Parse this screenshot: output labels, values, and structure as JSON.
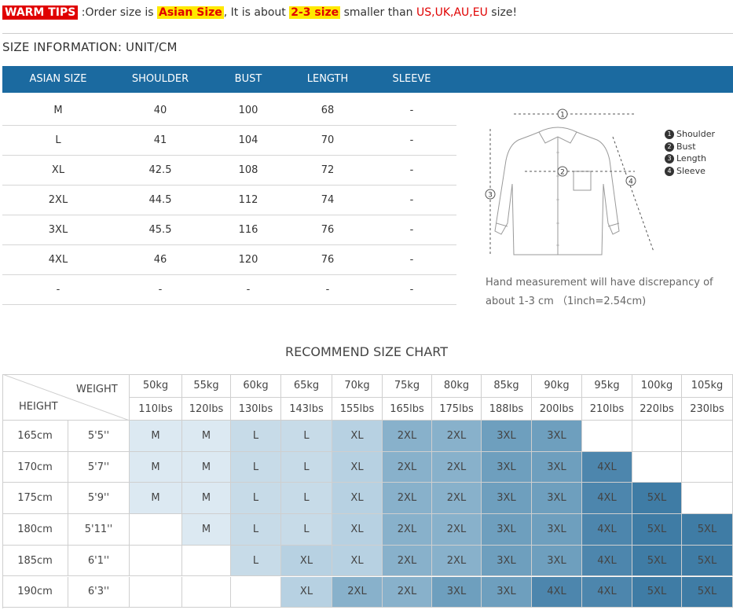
{
  "tips": {
    "tag": "WARM TIPS",
    "p1": " :Order size is ",
    "hl1": "Asian Size",
    "p2": ", It is about ",
    "hl2": "2-3 size",
    "p3": " smaller than ",
    "red": "US,UK,AU,EU",
    "p4": " size!"
  },
  "size_info": "SIZE INFORMATION:  UNIT/CM",
  "size_table": {
    "headers": [
      "ASIAN SIZE",
      "SHOULDER",
      "BUST",
      "LENGTH",
      "SLEEVE"
    ],
    "rows": [
      [
        "M",
        "40",
        "100",
        "68",
        "-"
      ],
      [
        "L",
        "41",
        "104",
        "70",
        "-"
      ],
      [
        "XL",
        "42.5",
        "108",
        "72",
        "-"
      ],
      [
        "2XL",
        "44.5",
        "112",
        "74",
        "-"
      ],
      [
        "3XL",
        "45.5",
        "116",
        "76",
        "-"
      ],
      [
        "4XL",
        "46",
        "120",
        "76",
        "-"
      ],
      [
        "-",
        "-",
        "-",
        "-",
        "-"
      ]
    ]
  },
  "legend": [
    {
      "num": "1",
      "label": "Shoulder"
    },
    {
      "num": "2",
      "label": "Bust"
    },
    {
      "num": "3",
      "label": "Length"
    },
    {
      "num": "4",
      "label": "Sleeve"
    }
  ],
  "diagram_marks": [
    "1",
    "2",
    "3",
    "4"
  ],
  "note_line1": "Hand measurement will have discrepancy of",
  "note_line2": "about 1-3 cm （1inch=2.54cm)",
  "recommend": {
    "title": "RECOMMEND SIZE CHART",
    "weight_label": "WEIGHT",
    "height_label": "HEIGHT",
    "weights_kg": [
      "50kg",
      "55kg",
      "60kg",
      "65kg",
      "70kg",
      "75kg",
      "80kg",
      "85kg",
      "90kg",
      "95kg",
      "100kg",
      "105kg"
    ],
    "weights_lbs": [
      "110lbs",
      "120lbs",
      "130lbs",
      "143lbs",
      "155lbs",
      "165lbs",
      "175lbs",
      "188lbs",
      "200lbs",
      "210lbs",
      "220lbs",
      "230lbs"
    ],
    "rows": [
      {
        "cm": "165cm",
        "ft": "5'5''",
        "sizes": [
          "M",
          "M",
          "L",
          "L",
          "XL",
          "2XL",
          "2XL",
          "3XL",
          "3XL",
          "",
          "",
          ""
        ]
      },
      {
        "cm": "170cm",
        "ft": "5'7''",
        "sizes": [
          "M",
          "M",
          "L",
          "L",
          "XL",
          "2XL",
          "2XL",
          "3XL",
          "3XL",
          "4XL",
          "",
          ""
        ]
      },
      {
        "cm": "175cm",
        "ft": "5'9''",
        "sizes": [
          "M",
          "M",
          "L",
          "L",
          "XL",
          "2XL",
          "2XL",
          "3XL",
          "3XL",
          "4XL",
          "5XL",
          ""
        ]
      },
      {
        "cm": "180cm",
        "ft": "5'11''",
        "sizes": [
          "",
          "M",
          "L",
          "L",
          "XL",
          "2XL",
          "2XL",
          "3XL",
          "3XL",
          "4XL",
          "5XL",
          "5XL"
        ]
      },
      {
        "cm": "185cm",
        "ft": "6'1''",
        "sizes": [
          "",
          "",
          "L",
          "XL",
          "XL",
          "2XL",
          "2XL",
          "3XL",
          "3XL",
          "4XL",
          "5XL",
          "5XL"
        ]
      },
      {
        "cm": "190cm",
        "ft": "6'3''",
        "sizes": [
          "",
          "",
          "",
          "XL",
          "2XL",
          "2XL",
          "3XL",
          "3XL",
          "4XL",
          "4XL",
          "5XL",
          "5XL"
        ]
      }
    ],
    "size_colors": {
      "M": "#dce9f2",
      "L": "#c7dbe8",
      "XL": "#b7d1e2",
      "2XL": "#88b1cb",
      "3XL": "#6e9fbe",
      "4XL": "#4d86ad",
      "5XL": "#3f7ca5"
    }
  }
}
